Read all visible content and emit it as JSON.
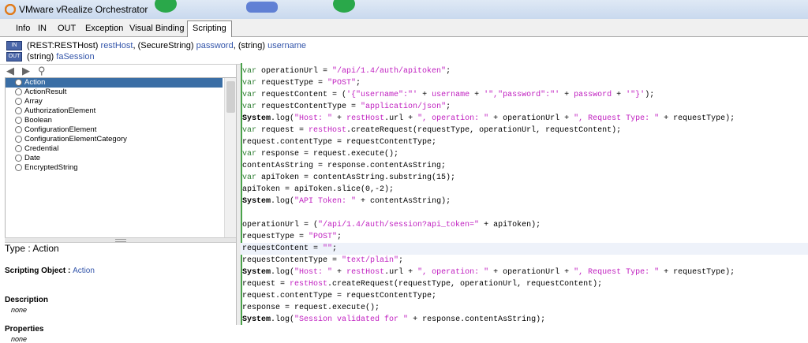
{
  "window": {
    "title": "VMware vRealize Orchestrator"
  },
  "tabs": [
    {
      "label": "Info"
    },
    {
      "label": "IN"
    },
    {
      "label": "OUT"
    },
    {
      "label": "Exception"
    },
    {
      "label": "Visual Binding"
    },
    {
      "label": "Scripting",
      "active": true
    }
  ],
  "params": {
    "in_badge": "IN",
    "out_badge": "OUT",
    "in_row": {
      "t1": "(REST:RESTHost)",
      "n1": "restHost",
      "sep1": ",",
      "t2": "(SecureString)",
      "n2": "password",
      "sep2": ",",
      "t3": "(string)",
      "n3": "username"
    },
    "out_row": {
      "t1": "(string)",
      "n1": "faSession"
    }
  },
  "nav": {
    "back_icon": "◀",
    "forward_icon": "▶",
    "search_icon": "⚲"
  },
  "tree": {
    "items": [
      {
        "label": "Action",
        "selected": true
      },
      {
        "label": "ActionResult"
      },
      {
        "label": "Array"
      },
      {
        "label": "AuthorizationElement"
      },
      {
        "label": "Boolean"
      },
      {
        "label": "ConfigurationElement"
      },
      {
        "label": "ConfigurationElementCategory"
      },
      {
        "label": "Credential"
      },
      {
        "label": "Date"
      },
      {
        "label": "EncryptedString"
      }
    ]
  },
  "info": {
    "type_prefix": "Type : ",
    "type_value": "Action",
    "scripting_object_label": "Scripting Object : ",
    "scripting_object_value": "Action",
    "description_label": "Description",
    "description_value": "none",
    "properties_label": "Properties",
    "properties_value": "none"
  },
  "code": {
    "highlighted_line": 15,
    "lines": [
      [
        [
          "k",
          "var"
        ],
        [
          "n",
          " operationUrl = "
        ],
        [
          "s",
          "\"/api/1.4/auth/apitoken\""
        ],
        [
          "n",
          ";"
        ]
      ],
      [
        [
          "k",
          "var"
        ],
        [
          "n",
          " requestType = "
        ],
        [
          "s",
          "\"POST\""
        ],
        [
          "n",
          ";"
        ]
      ],
      [
        [
          "k",
          "var"
        ],
        [
          "n",
          " requestContent = ("
        ],
        [
          "s",
          "'{\"username\":\"'"
        ],
        [
          "n",
          " + "
        ],
        [
          "o",
          "username"
        ],
        [
          "n",
          " + "
        ],
        [
          "s",
          "'\",\"password\":\"'"
        ],
        [
          "n",
          " + "
        ],
        [
          "o",
          "password"
        ],
        [
          "n",
          " + "
        ],
        [
          "s",
          "'\"}'"
        ],
        [
          "n",
          ");"
        ]
      ],
      [
        [
          "k",
          "var"
        ],
        [
          "n",
          " requestContentType = "
        ],
        [
          "s",
          "\"application/json\""
        ],
        [
          "n",
          ";"
        ]
      ],
      [
        [
          "b",
          "System"
        ],
        [
          "n",
          ".log("
        ],
        [
          "s",
          "\"Host: \""
        ],
        [
          "n",
          " + "
        ],
        [
          "o",
          "restHost"
        ],
        [
          "n",
          ".url + "
        ],
        [
          "s",
          "\", operation: \""
        ],
        [
          "n",
          " + operationUrl + "
        ],
        [
          "s",
          "\", Request Type: \""
        ],
        [
          "n",
          " + requestType);"
        ]
      ],
      [
        [
          "k",
          "var"
        ],
        [
          "n",
          " request = "
        ],
        [
          "o",
          "restHost"
        ],
        [
          "n",
          ".createRequest(requestType, operationUrl, requestContent);"
        ]
      ],
      [
        [
          "n",
          "request.contentType = requestContentType;"
        ]
      ],
      [
        [
          "k",
          "var"
        ],
        [
          "n",
          " response = request.execute();"
        ]
      ],
      [
        [
          "n",
          "contentAsString = response.contentAsString;"
        ]
      ],
      [
        [
          "k",
          "var"
        ],
        [
          "n",
          " apiToken = contentAsString.substring(15);"
        ]
      ],
      [
        [
          "n",
          "apiToken = apiToken.slice(0,-2);"
        ]
      ],
      [
        [
          "b",
          "System"
        ],
        [
          "n",
          ".log("
        ],
        [
          "s",
          "\"API Token: \""
        ],
        [
          "n",
          " + contentAsString);"
        ]
      ],
      [
        [
          "n",
          ""
        ]
      ],
      [
        [
          "n",
          "operationUrl = ("
        ],
        [
          "s",
          "\"/api/1.4/auth/session?api_token=\""
        ],
        [
          "n",
          " + apiToken);"
        ]
      ],
      [
        [
          "n",
          "requestType = "
        ],
        [
          "s",
          "\"POST\""
        ],
        [
          "n",
          ";"
        ]
      ],
      [
        [
          "n",
          "requestContent = "
        ],
        [
          "s",
          "\"\""
        ],
        [
          "n",
          ";"
        ]
      ],
      [
        [
          "n",
          "requestContentType = "
        ],
        [
          "s",
          "\"text/plain\""
        ],
        [
          "n",
          ";"
        ]
      ],
      [
        [
          "b",
          "System"
        ],
        [
          "n",
          ".log("
        ],
        [
          "s",
          "\"Host: \""
        ],
        [
          "n",
          " + "
        ],
        [
          "o",
          "restHost"
        ],
        [
          "n",
          ".url + "
        ],
        [
          "s",
          "\", operation: \""
        ],
        [
          "n",
          " + operationUrl + "
        ],
        [
          "s",
          "\", Request Type: \""
        ],
        [
          "n",
          " + requestType);"
        ]
      ],
      [
        [
          "n",
          "request = "
        ],
        [
          "o",
          "restHost"
        ],
        [
          "n",
          ".createRequest(requestType, operationUrl, requestContent);"
        ]
      ],
      [
        [
          "n",
          "request.contentType = requestContentType;"
        ]
      ],
      [
        [
          "n",
          "response = request.execute();"
        ]
      ],
      [
        [
          "b",
          "System"
        ],
        [
          "n",
          ".log("
        ],
        [
          "s",
          "\"Session validated for \""
        ],
        [
          "n",
          " + response.contentAsString);"
        ]
      ]
    ]
  }
}
